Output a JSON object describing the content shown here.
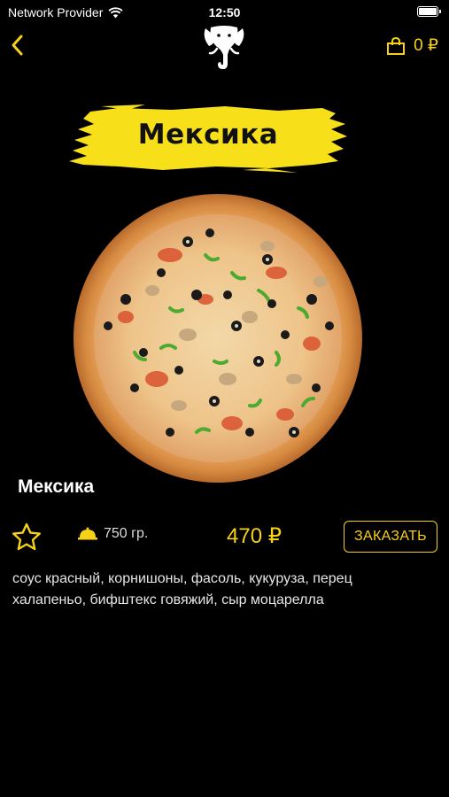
{
  "status_bar": {
    "carrier": "Network Provider",
    "time": "12:50"
  },
  "nav": {
    "cart_total": "0 ₽"
  },
  "banner": {
    "title": "Мексика"
  },
  "product": {
    "name": "Мексика",
    "weight": "750 гр.",
    "price": "470 ₽",
    "order_label": "ЗАКАЗАТЬ",
    "description": "соус красный, корнишоны, фасоль, кукуруза, перец халапеньо, бифштекс говяжий, сыр моцарелла"
  },
  "colors": {
    "accent": "#f7d117",
    "background": "#000000"
  },
  "icons": [
    "wifi-icon",
    "battery-icon",
    "back-chevron-icon",
    "elephant-logo",
    "shopping-bag-icon",
    "star-icon",
    "dish-cloche-icon"
  ]
}
